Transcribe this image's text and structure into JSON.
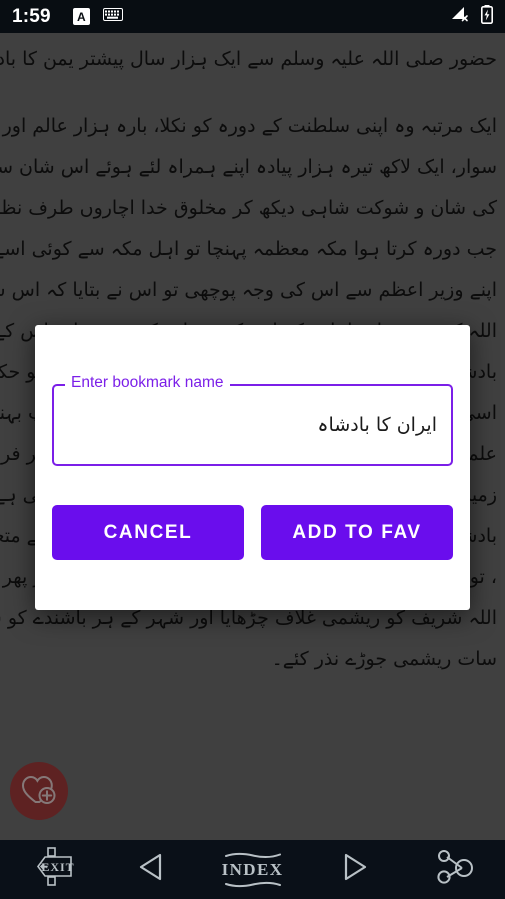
{
  "status_bar": {
    "time": "1:59",
    "ime_badge": "A",
    "icons": {
      "keyboard": "keyboard-icon",
      "signal": "signal-no-service-icon",
      "battery": "battery-charging-icon"
    }
  },
  "reader": {
    "lines": [
      "حضور صلی اللہ علیہ وسلم سے ایک ہزار سال پیشتر یمن کا بادشاہ تبع خمیری تھا،",
      "ایک مرتبہ وہ اپنی سلطنت کے دورہ کو نکلا، بارہ ہزار عالم اور حکیم اور ایک لاکھ بتیس ہزار",
      "سوار، ایک لاکھ تیرہ ہزار پیادہ اپنے ہمراہ لئے ہوئے اس شان سے نکلا کہ جہاں بھی پہنچتا اس",
      "کی شان و شوکت شاہی دیکھ کر مخلوق خدا اچاروں طرف نظارہ کو جمع ہو جاتی تھی، یہ بادشاہ",
      "جب دورہ کرتا ہوا مکہ معظمہ پہنچا تو اہل مکہ سے کوئی اسے دیکھنے نہ آیا۔ بادشاہ حیران ہوا اور",
      "اپنے وزیر اعظم سے اس کی وجہ پوچھی تو اس نے بتایا کہ اس شہر میں ایک گھر ہے جسے بیت",
      "اللہ کہتے ہیں اور اہل مکہ اس کی تعظیم کرتے ہیں اور اس کے سوا کسی کی تعظیم نہیں کرتے۔",
      "بادشاہ کو یہ بات بہت ناگوار گزری اور اس نے اپنے لشکر کو حکم دیا کہ اس گھر کو ڈھا دو۔",
      "اسی وقت بادشاہ کے ناک، کان اور آنکھوں سے خون اور پیپ بہنے لگی۔",
      "علماء میں سے ایک عالم ربانی تشریف لائے اور نبض دیکھ کر فرمایا، مرض آسمانی ہے اور علاج",
      "زمین کا ہو رہا ہے، اے بادشاہ! آپ نے اگر کوئی بری نیت کی ہے تو فوراً اس سے توبہ کریں،",
      "بادشاہ نے دل ہی دل میں بیت اللہ شریف اور خدام کعبہ کے متعلق اپنے ارادے سے توبہ کی",
      "، توبہ کرتے ہی اس کا وہ خون اور مادہ بہنا بند ہو گیا، اور پھر صحت کی خوشی میں اس نے بیت",
      "اللہ شریف کو ریشمی غلاف چڑھایا اور شہر کے ہر باشندے کو سات سات اشرفی اور سات",
      "سات ریشمی جوڑے نذر کئے۔"
    ]
  },
  "fab": {
    "name": "add-to-favorites-fab",
    "icon": "heart-plus-icon",
    "color": "#a33b3b"
  },
  "dialog": {
    "field_label": "Enter bookmark name",
    "field_value": "ایران کا بادشاہ",
    "field_placeholder": "Enter bookmark name",
    "cancel_label": "CANCEL",
    "confirm_label": "ADD TO FAV",
    "accent_color": "#7b1fe8",
    "button_color": "#6a0ded"
  },
  "bottom_nav": {
    "items": [
      {
        "name": "exit",
        "label": "EXIT",
        "icon": "exit-sign-icon"
      },
      {
        "name": "previous",
        "label": "",
        "icon": "triangle-left-icon"
      },
      {
        "name": "index",
        "label": "INDEX",
        "icon": "index-label-icon"
      },
      {
        "name": "next",
        "label": "",
        "icon": "triangle-right-icon"
      },
      {
        "name": "share",
        "label": "",
        "icon": "share-nodes-icon"
      }
    ]
  }
}
